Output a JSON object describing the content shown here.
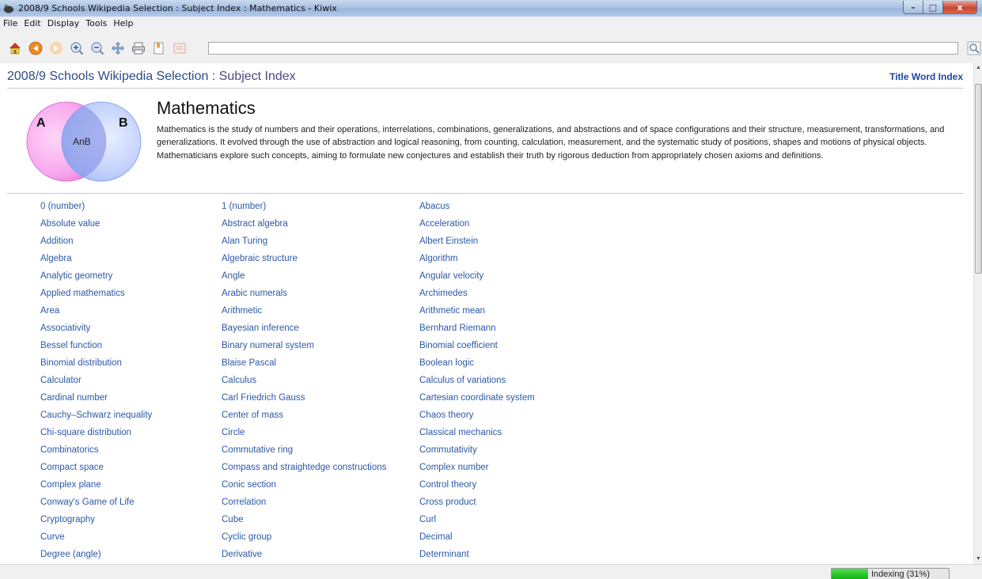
{
  "window": {
    "title": "2008/9 Schools Wikipedia Selection : Subject Index : Mathematics - Kiwix",
    "controls": {
      "minimize": "–",
      "maximize": "□",
      "close": "x"
    }
  },
  "menu": {
    "items": [
      "File",
      "Edit",
      "Display",
      "Tools",
      "Help"
    ]
  },
  "toolbar": {
    "address_value": ""
  },
  "page": {
    "site_title": "2008/9 Schools Wikipedia Selection",
    "separator": " : ",
    "section": "Subject Index",
    "title_word_index": "Title Word Index",
    "venn": {
      "a": "A",
      "b": "B",
      "intersection": "AnB"
    },
    "subject": "Mathematics",
    "description": "Mathematics is the study of numbers and their operations, interrelations, combinations, generalizations, and abstractions and of space configurations and their structure, measurement, transformations, and generalizations. It evolved through the use of abstraction and logical reasoning, from counting, calculation, measurement, and the systematic study of positions, shapes and motions of physical objects. Mathematicians explore such concepts, aiming to formulate new conjectures and establish their truth by rigorous deduction from appropriately chosen axioms and definitions.",
    "columns": [
      [
        "0 (number)",
        "Absolute value",
        "Addition",
        "Algebra",
        "Analytic geometry",
        "Applied mathematics",
        "Area",
        "Associativity",
        "Bessel function",
        "Binomial distribution",
        "Calculator",
        "Cardinal number",
        "Cauchy–Schwarz inequality",
        "Chi-square distribution",
        "Combinatorics",
        "Compact space",
        "Complex plane",
        "Conway's Game of Life",
        "Cryptography",
        "Curve",
        "Degree (angle)"
      ],
      [
        "1 (number)",
        "Abstract algebra",
        "Alan Turing",
        "Algebraic structure",
        "Angle",
        "Arabic numerals",
        "Arithmetic",
        "Bayesian inference",
        "Binary numeral system",
        "Blaise Pascal",
        "Calculus",
        "Carl Friedrich Gauss",
        "Center of mass",
        "Circle",
        "Commutative ring",
        "Compass and straightedge constructions",
        "Conic section",
        "Correlation",
        "Cube",
        "Cyclic group",
        "Derivative"
      ],
      [
        "Abacus",
        "Acceleration",
        "Albert Einstein",
        "Algorithm",
        "Angular velocity",
        "Archimedes",
        "Arithmetic mean",
        "Bernhard Riemann",
        "Binomial coefficient",
        "Boolean logic",
        "Calculus of variations",
        "Cartesian coordinate system",
        "Chaos theory",
        "Classical mechanics",
        "Commutativity",
        "Complex number",
        "Control theory",
        "Cross product",
        "Curl",
        "Decimal",
        "Determinant"
      ]
    ]
  },
  "status": {
    "indexing_label": "Indexing (31%)",
    "indexing_progress": 0.31
  },
  "colors": {
    "link": "#2b58a8",
    "site_title": "#2a4d86",
    "progress": "#13b113"
  }
}
